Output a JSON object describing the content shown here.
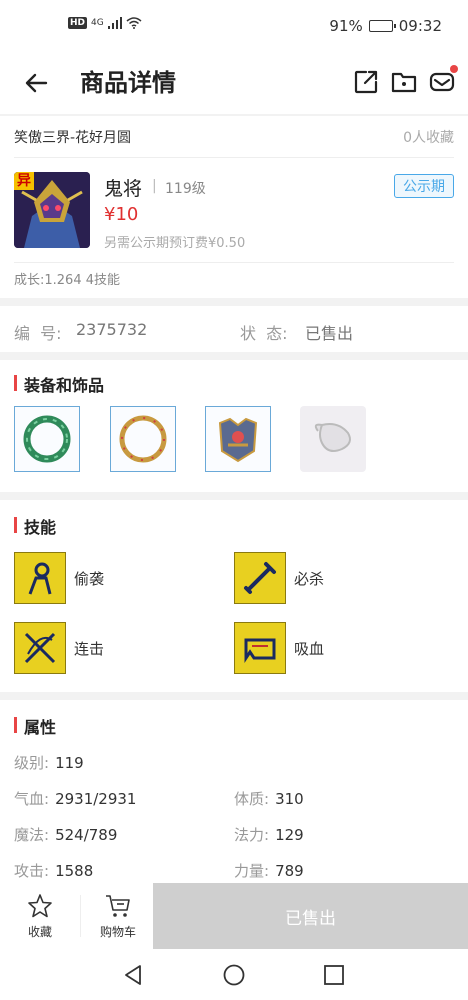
{
  "status_bar": {
    "hd": "HD",
    "network": "4G",
    "battery_percent": "91%",
    "battery_level": 0.91,
    "time": "09:32"
  },
  "nav": {
    "title": "商品详情",
    "icons": [
      "back-arrow-icon",
      "share-icon",
      "folder-star-icon",
      "message-icon"
    ]
  },
  "product": {
    "server": "笑傲三界-花好月圆",
    "collect_count": "0人收藏",
    "avatar_badge": "异",
    "name": "鬼将",
    "separator": "|",
    "level": "119级",
    "price": "¥10",
    "fee_note": "另需公示期预订费¥0.50",
    "tag": "公示期",
    "growth": "成长:1.264 4技能"
  },
  "info": {
    "id_label": "编  号:",
    "id_value": "2375732",
    "state_label": "状  态:",
    "state_value": "已售出"
  },
  "equipment": {
    "title": "装备和饰品",
    "items": [
      "jade-bracelet-icon",
      "gold-bracelet-icon",
      "armor-icon",
      "empty-slot-icon"
    ]
  },
  "skills": {
    "title": "技能",
    "items": [
      {
        "label": "偷袭",
        "icon": "sneak-attack-icon"
      },
      {
        "label": "必杀",
        "icon": "sword-icon"
      },
      {
        "label": "连击",
        "icon": "crossed-blades-icon"
      },
      {
        "label": "吸血",
        "icon": "vampire-icon"
      }
    ]
  },
  "attributes": {
    "title": "属性",
    "level_label": "级别:",
    "level_value": "119",
    "hp_label": "气血:",
    "hp_value": "2931/2931",
    "con_label": "体质:",
    "con_value": "310",
    "mp_label": "魔法:",
    "mp_value": "524/789",
    "mag_label": "法力:",
    "mag_value": "129",
    "atk_label": "攻击:",
    "atk_value": "1588",
    "str_label": "力量:",
    "str_value": "789"
  },
  "bottom": {
    "collect_label": "收藏",
    "cart_label": "购物车",
    "sold_label": "已售出"
  },
  "colors": {
    "accent_red": "#e84545",
    "price_red": "#e03030",
    "tag_blue": "#49a8e8",
    "sold_gray": "#cfcfcf"
  }
}
